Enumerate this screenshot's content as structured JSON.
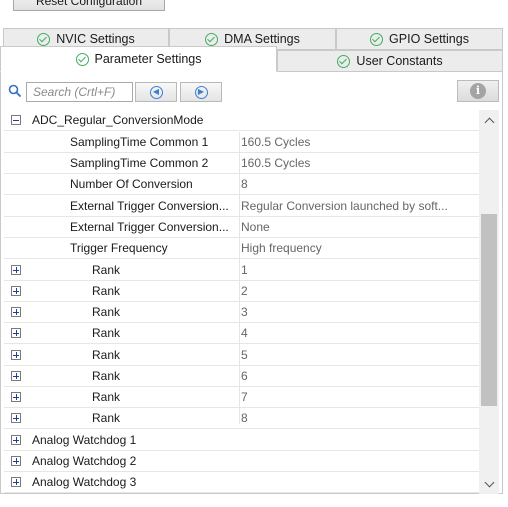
{
  "reset_button": {
    "label": "Reset Configuration"
  },
  "tabs": {
    "row1": [
      {
        "label": "NVIC Settings"
      },
      {
        "label": "DMA Settings"
      },
      {
        "label": "GPIO Settings"
      }
    ],
    "row2": [
      {
        "label": "Parameter Settings",
        "active": true
      },
      {
        "label": "User Constants"
      }
    ]
  },
  "toolbar": {
    "search_placeholder": "Search (Crtl+F)",
    "prev_icon": "arrow-left-circle-icon",
    "next_icon": "arrow-right-circle-icon",
    "info_icon": "info-icon",
    "info_glyph": "i"
  },
  "tree": {
    "group_header": "ADC_Regular_ConversionMode",
    "params": [
      {
        "name": "SamplingTime Common 1",
        "value": "160.5 Cycles"
      },
      {
        "name": "SamplingTime Common 2",
        "value": "160.5 Cycles"
      },
      {
        "name": "Number Of Conversion",
        "value": "8"
      },
      {
        "name": "External Trigger Conversion...",
        "value": "Regular Conversion launched by soft..."
      },
      {
        "name": "External Trigger Conversion...",
        "value": "None"
      },
      {
        "name": "Trigger Frequency",
        "value": "High frequency"
      }
    ],
    "ranks": [
      {
        "name": "Rank",
        "value": "1"
      },
      {
        "name": "Rank",
        "value": "2"
      },
      {
        "name": "Rank",
        "value": "3"
      },
      {
        "name": "Rank",
        "value": "4"
      },
      {
        "name": "Rank",
        "value": "5"
      },
      {
        "name": "Rank",
        "value": "6"
      },
      {
        "name": "Rank",
        "value": "7"
      },
      {
        "name": "Rank",
        "value": "8"
      }
    ],
    "groups_after": [
      {
        "name": "Analog Watchdog 1"
      },
      {
        "name": "Analog Watchdog 2"
      },
      {
        "name": "Analog Watchdog 3"
      }
    ]
  },
  "colors": {
    "check_green": "#3fae5f",
    "nav_blue": "#3a7fd1",
    "value_gray": "#666666"
  },
  "scrollbar": {
    "position_fraction": 0.55
  }
}
